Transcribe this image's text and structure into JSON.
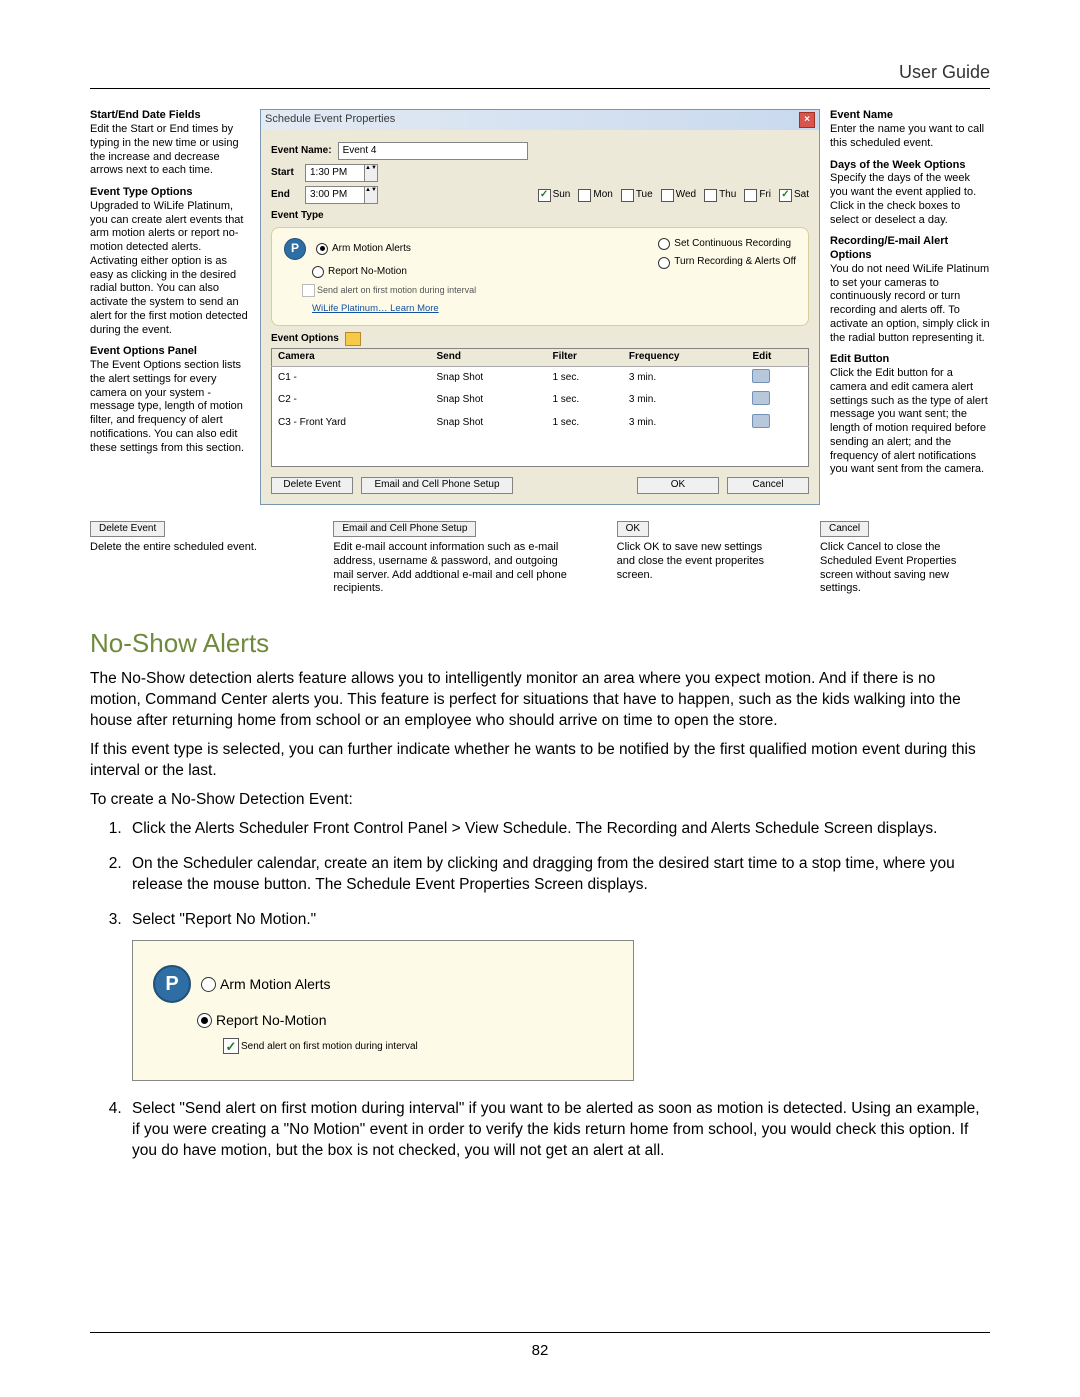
{
  "header": "User Guide",
  "page_number": "82",
  "left_blocks": [
    {
      "title": "Start/End Date Fields",
      "text": "Edit the Start or End times by typing in the new time or using the increase and decrease arrows next to each time."
    },
    {
      "title": "Event Type Options",
      "text": "Upgraded to WiLife Platinum, you can create alert events that arm motion alerts or report no-motion detected alerts. Activating either option is as easy as clicking in the desired radial button. You can also activate the system to send an alert for the first motion detected during the event."
    },
    {
      "title": "Event Options Panel",
      "text": "The Event Options section lists the alert settings for every camera on your system - message type, length of motion filter, and frequency of alert notifications. You can also edit these settings from this section."
    }
  ],
  "right_blocks": [
    {
      "title": "Event Name",
      "text": "Enter the name you want to call this scheduled event."
    },
    {
      "title": "Days of the Week Options",
      "text": "Specify the days of the week you want the event applied to. Click in the check boxes to select or deselect a day."
    },
    {
      "title": "Recording/E-mail Alert Options",
      "text": "You do not need WiLife Platinum to set your cameras to continuously record or turn recording and alerts off. To activate an option, simply click in the radial button representing it."
    },
    {
      "title": "Edit Button",
      "text": "Click the Edit button for a camera and edit camera alert settings such as the type of alert message you want sent; the length of motion required before sending an alert; and the frequency of alert notifications you want sent from the camera."
    }
  ],
  "dialog": {
    "title": "Schedule Event Properties",
    "event_name_label": "Event Name:",
    "event_name_value": "Event 4",
    "start_label": "Start",
    "start_value": "1:30 PM",
    "end_label": "End",
    "end_value": "3:00 PM",
    "days": [
      {
        "label": "Sun",
        "checked": true
      },
      {
        "label": "Mon",
        "checked": false
      },
      {
        "label": "Tue",
        "checked": false
      },
      {
        "label": "Wed",
        "checked": false
      },
      {
        "label": "Thu",
        "checked": false
      },
      {
        "label": "Fri",
        "checked": false
      },
      {
        "label": "Sat",
        "checked": true
      }
    ],
    "event_type_label": "Event Type",
    "arm_label": "Arm Motion Alerts",
    "report_label": "Report No-Motion",
    "send_first_label": "Send alert on first motion during interval",
    "learn_label": "WiLife Platinum… Learn More",
    "set_cont_label": "Set Continuous Recording",
    "turn_off_label": "Turn Recording & Alerts Off",
    "event_options_label": "Event Options",
    "table_headers": {
      "camera": "Camera",
      "send": "Send",
      "filter": "Filter",
      "freq": "Frequency",
      "edit": "Edit"
    },
    "table_rows": [
      {
        "camera": "C1 -",
        "send": "Snap Shot",
        "filter": "1 sec.",
        "freq": "3 min."
      },
      {
        "camera": "C2 -",
        "send": "Snap Shot",
        "filter": "1 sec.",
        "freq": "3 min."
      },
      {
        "camera": "C3 - Front Yard",
        "send": "Snap Shot",
        "filter": "1 sec.",
        "freq": "3 min."
      }
    ],
    "btn_delete": "Delete Event",
    "btn_email": "Email and Cell Phone Setup",
    "btn_ok": "OK",
    "btn_cancel": "Cancel"
  },
  "callouts": [
    {
      "btn": "Delete Event",
      "text": "Delete the entire scheduled event."
    },
    {
      "btn": "Email and Cell Phone Setup",
      "text": "Edit e-mail account information such as e-mail address, username & password, and outgoing mail server. Add addtional e-mail and cell phone recipients."
    },
    {
      "btn": "OK",
      "text": "Click OK to save new settings and close the event properites screen."
    },
    {
      "btn": "Cancel",
      "text": "Click Cancel to close the Scheduled Event Properties screen without saving new settings."
    }
  ],
  "noshow": {
    "heading": "No-Show Alerts",
    "p1": "The No-Show detection alerts feature allows you to intelligently monitor an area where you expect motion. And if there is no motion, Command Center alerts you. This feature is perfect for situations that have to happen, such as the kids walking into the house after returning home from school or an employee who should arrive on time to open the store.",
    "p2": "If this event type is selected, you can further indicate whether he wants to be notified by the first qualified motion event during this interval or the last.",
    "p3": "To create a No-Show Detection Event:",
    "steps": [
      "Click the Alerts Scheduler Front Control Panel > View Schedule.  The Recording and Alerts Schedule Screen displays.",
      "On the Scheduler calendar, create an item by clicking and dragging from the desired start time to a stop time, where you release the mouse button.  The Schedule Event Properties Screen displays.",
      "Select \"Report No Motion.\"",
      "Select \"Send alert on first motion during interval\" if you want to be alerted as soon as motion is detected.  Using an example, if you were creating a \"No Motion\" event in order to verify the kids return home from school, you would check this option. If you do have motion, but the box is not checked, you will not get an alert at all."
    ],
    "inset": {
      "arm": "Arm Motion Alerts",
      "report": "Report No-Motion",
      "send_first": "Send alert on first motion during interval"
    }
  }
}
